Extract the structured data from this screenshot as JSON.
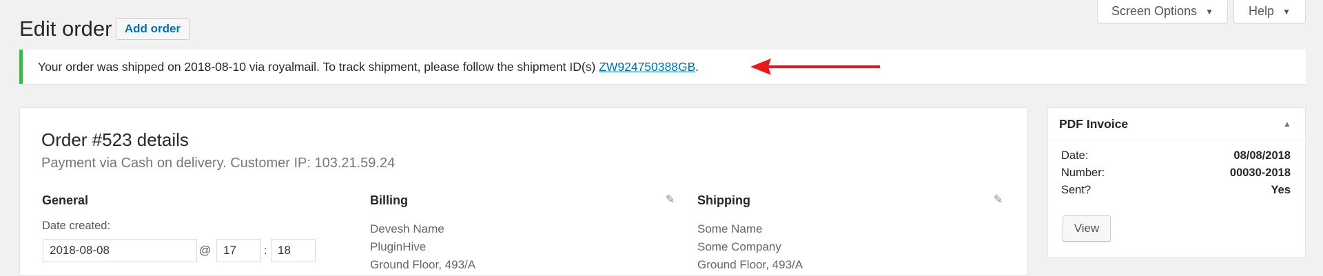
{
  "header": {
    "title": "Edit order",
    "add_button": "Add order",
    "screen_options": "Screen Options",
    "help": "Help"
  },
  "notice": {
    "text": "Your order was shipped on 2018-08-10 via royalmail. To track shipment, please follow the shipment ID(s) ",
    "tracking_id": "ZW924750388GB",
    "suffix": "."
  },
  "order": {
    "title": "Order #523 details",
    "subtitle": "Payment via Cash on delivery. Customer IP: 103.21.59.24",
    "general": {
      "heading": "General",
      "date_label": "Date created:",
      "date_value": "2018-08-08",
      "at": "@",
      "hour": "17",
      "colon": ":",
      "minute": "18"
    },
    "billing": {
      "heading": "Billing",
      "lines": [
        "Devesh Name",
        "PluginHive",
        "Ground Floor, 493/A"
      ]
    },
    "shipping": {
      "heading": "Shipping",
      "lines": [
        "Some Name",
        "Some Company",
        "Ground Floor, 493/A"
      ]
    }
  },
  "invoice": {
    "title": "PDF Invoice",
    "rows": [
      {
        "label": "Date:",
        "value": "08/08/2018"
      },
      {
        "label": "Number:",
        "value": "00030-2018"
      },
      {
        "label": "Sent?",
        "value": "Yes"
      }
    ],
    "view_button": "View"
  },
  "colors": {
    "notice_border": "#46b450",
    "link": "#0073aa",
    "arrow": "#e8191b"
  },
  "icons": {
    "caret": "caret-down-icon",
    "edit": "pencil-icon",
    "toggle": "caret-up-icon",
    "annotation": "red-arrow-icon"
  }
}
